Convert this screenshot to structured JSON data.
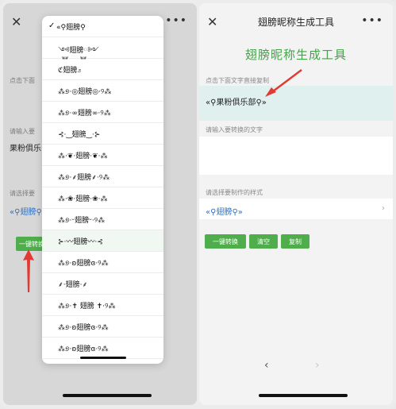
{
  "left_panel": {
    "top_close": "✕",
    "top_more": "•••",
    "label_copy": "点击下面",
    "label_input": "请输入要",
    "input_value": "果粉俱乐",
    "label_style": "请选择要",
    "style_value": "«⚲翅膀⚲",
    "convert_button": "一键转换",
    "dropdown": {
      "items": [
        {
          "label": "«⚲翅膀⚲",
          "selected": true
        },
        {
          "label": "༺࿆翅膀࿆༻"
        },
        {
          "label": "ℭ翅膀೨"
        },
        {
          "label": "⁂୭·◎翅膀◎·୨⁂"
        },
        {
          "label": "⁂୭·∞翅膀∞·୨⁂"
        },
        {
          "label": "⊰·‿翅膀‿·⊱"
        },
        {
          "label": "⁂·❦·翅膀·❦·⁂"
        },
        {
          "label": "⁂୭·⸙翅膀⸙·୨⁂"
        },
        {
          "label": "⁂·❀·翅膀·❀·⁂"
        },
        {
          "label": "⁂୭·ᵕ翅膀ᵕ·୨⁂"
        },
        {
          "label": "⊱·〰翅膀〰·⊰",
          "highlight": true
        },
        {
          "label": "⁂୭·ʚ翅膀ɞ·୨⁂"
        },
        {
          "label": "⸙·翅膀·⸙"
        },
        {
          "label": "⁂୭·✝ 翅膀 ✝·୨⁂"
        },
        {
          "label": "⁂୭·ʚ翅膀ɞ·୨⁂"
        },
        {
          "label": "⁂୭·ʚ翅膀ɞ·୨⁂"
        }
      ]
    }
  },
  "right_panel": {
    "top_close": "✕",
    "top_title": "翅膀昵称生成工具",
    "top_more": "•••",
    "green_title": "翅膀昵称生成工具",
    "label_copy": "点击下面文字直接复制",
    "output_value": "«⚲果粉俱乐部⚲»",
    "label_input": "请输入要转换的文字",
    "label_style": "请选择要制作的样式",
    "style_value": "«⚲翅膀⚲»",
    "buttons": {
      "convert": "一键转换",
      "clear": "清空",
      "copy": "复制"
    },
    "nav": {
      "back": "‹",
      "forward": "›"
    }
  },
  "colors": {
    "accent_green": "#45a14a",
    "button_green": "#4fae4b",
    "arrow_red": "#e23a32",
    "link_blue": "#2f6fc0"
  }
}
